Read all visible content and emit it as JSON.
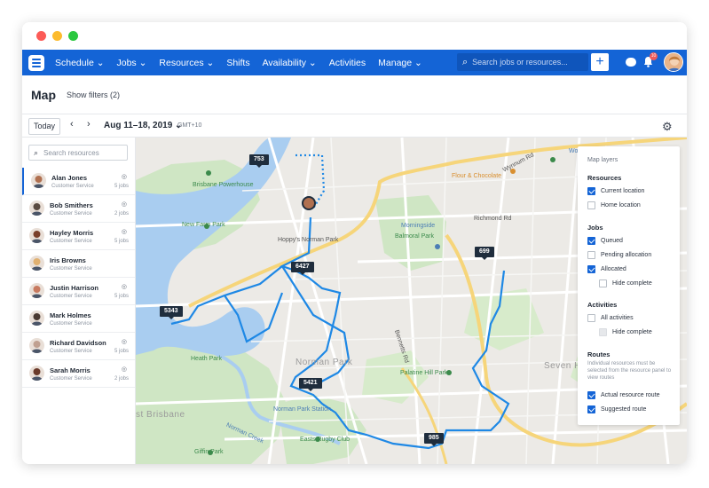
{
  "nav": {
    "items": [
      {
        "label": "Schedule ⌄"
      },
      {
        "label": "Jobs ⌄"
      },
      {
        "label": "Resources ⌄"
      },
      {
        "label": "Shifts"
      },
      {
        "label": "Availability ⌄"
      },
      {
        "label": "Activities"
      },
      {
        "label": "Manage ⌄"
      }
    ],
    "search_placeholder": "Search jobs or resources...",
    "notification_count": "10"
  },
  "page": {
    "title": "Map",
    "filters": "Show filters (2)"
  },
  "datebar": {
    "today": "Today",
    "date_range": "Aug 11–18, 2019 ⌄",
    "timezone": "GMT+10"
  },
  "sidebar": {
    "search_placeholder": "Search resources",
    "resources": [
      {
        "name": "Alan Jones",
        "role": "Customer Service",
        "jobs": "5 jobs",
        "color": "#b07050"
      },
      {
        "name": "Bob Smithers",
        "role": "Customer Service",
        "jobs": "2 jobs",
        "color": "#5a4a40"
      },
      {
        "name": "Hayley Morris",
        "role": "Customer Service",
        "jobs": "5 jobs",
        "color": "#7a3f2a"
      },
      {
        "name": "Iris Browns",
        "role": "Customer Service",
        "jobs": "",
        "color": "#e0b070"
      },
      {
        "name": "Justin Harrison",
        "role": "Customer Service",
        "jobs": "5 jobs",
        "color": "#c87a60"
      },
      {
        "name": "Mark Holmes",
        "role": "Customer Service",
        "jobs": "",
        "color": "#4a3a32"
      },
      {
        "name": "Richard Davidson",
        "role": "Customer Service",
        "jobs": "5 jobs",
        "color": "#c0a090"
      },
      {
        "name": "Sarah Morris",
        "role": "Customer Service",
        "jobs": "2 jobs",
        "color": "#6a3a2a"
      }
    ]
  },
  "map": {
    "markers": [
      "753",
      "6427",
      "5343",
      "699",
      "5421",
      "985"
    ],
    "labels": {
      "powerhouse": "Brisbane Powerhouse",
      "new_farm_park": "New Farm Park",
      "hoppys": "Hoppy's Norman Park",
      "balmoral": "Balmoral Park",
      "morningside": "Morningside",
      "flour": "Flour & Chocolate",
      "woolworths": "Woolworths",
      "wynnum": "Wynnum Rd",
      "richmond": "Richmond Rd",
      "heath": "Heath Park",
      "norman_park": "Norman Park",
      "palatine": "Palatine Hill Park",
      "seven_hills": "Seven Hills",
      "station": "Norman Park Station",
      "east_brisbane": "st Brisbane",
      "norman_creek": "Norman Creek",
      "easts": "Easts Rugby Club",
      "giffin": "Giffin Park",
      "bennetts": "Bennetts Rd"
    }
  },
  "layers": {
    "title": "Map layers",
    "resources_title": "Resources",
    "current_location": "Current location",
    "home_location": "Home location",
    "jobs_title": "Jobs",
    "queued": "Queued",
    "pending": "Pending allocation",
    "allocated": "Allocated",
    "hide_complete": "Hide complete",
    "activities_title": "Activities",
    "all_activities": "All activities",
    "hide_complete_2": "Hide complete",
    "routes_title": "Routes",
    "routes_note": "Individual resources must be selected from the resource panel to view routes",
    "actual_route": "Actual resource route",
    "suggested_route": "Suggested route"
  }
}
